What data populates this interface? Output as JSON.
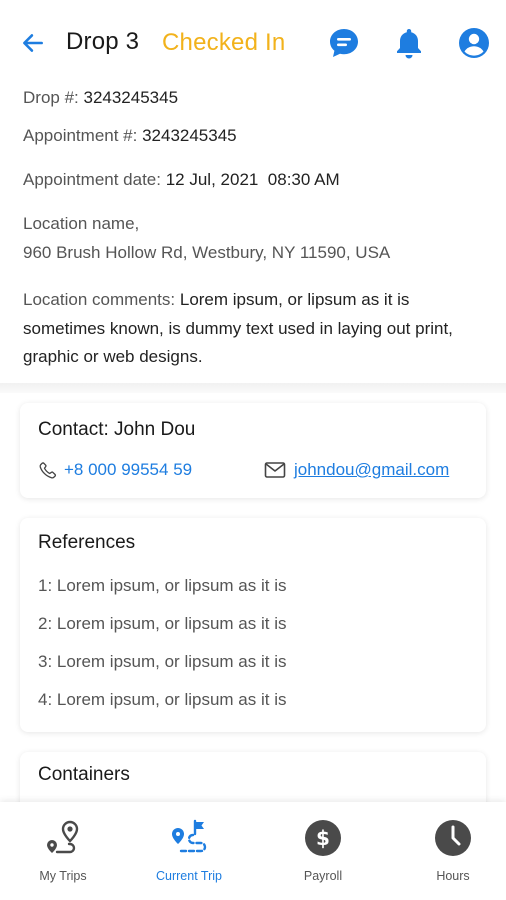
{
  "header": {
    "title": "Drop 3",
    "status": "Checked In"
  },
  "details": {
    "drop_label": "Drop #: ",
    "drop_value": "3243245345",
    "appointment_label": "Appointment #: ",
    "appointment_value": "3243245345",
    "appt_date_label": "Appointment date: ",
    "appt_date_value": "12 Jul, 2021  08:30 AM",
    "location_label": "Location name,",
    "location_value": "960 Brush Hollow Rd, Westbury, NY 11590, USA",
    "comments_label": "Location comments: ",
    "comments_value": "Lorem ipsum, or lipsum as it is sometimes known, is dummy text used in laying out print, graphic or web designs."
  },
  "contact": {
    "title": "Contact: John Dou",
    "phone": "+8 000 99554 59",
    "email": "johndou@gmail.com"
  },
  "references": {
    "title": "References",
    "items": [
      "1: Lorem ipsum, or lipsum as it is",
      "2: Lorem ipsum, or lipsum as it is",
      "3: Lorem ipsum, or lipsum as it is",
      "4: Lorem ipsum, or lipsum as it is"
    ]
  },
  "containers": {
    "title": "Containers"
  },
  "nav": {
    "items": [
      {
        "label": "My Trips",
        "icon": "route-pin-icon",
        "active": false
      },
      {
        "label": "Current Trip",
        "icon": "current-trip-icon",
        "active": true
      },
      {
        "label": "Payroll",
        "icon": "dollar-icon",
        "active": false
      },
      {
        "label": "Hours",
        "icon": "clock-icon",
        "active": false
      }
    ]
  },
  "colors": {
    "accent": "#1e7de0",
    "status": "#f2b21b",
    "icon_gray": "#4a4a4a"
  }
}
